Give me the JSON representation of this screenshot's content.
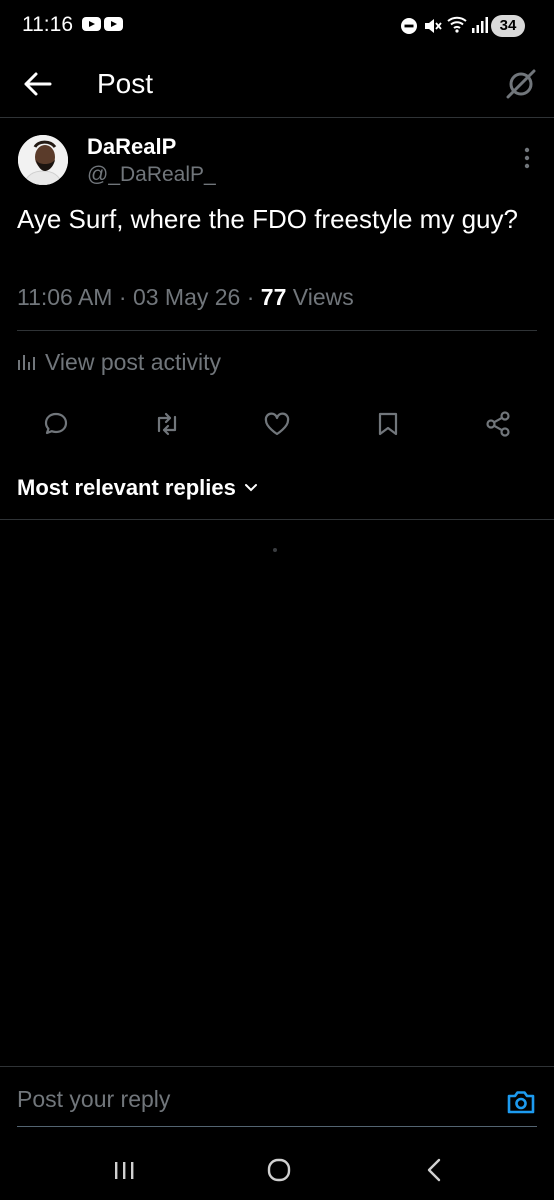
{
  "status_bar": {
    "time": "11:16",
    "battery": "34"
  },
  "header": {
    "title": "Post"
  },
  "post": {
    "author_name": "DaRealP",
    "author_handle": "@_DaRealP_",
    "text": "Aye Surf, where the FDO freestyle my guy?",
    "time": "11:06 AM",
    "date": "03 May 26",
    "views_count": "77",
    "views_label": "Views",
    "activity_label": "View post activity"
  },
  "replies": {
    "sort_label": "Most relevant replies"
  },
  "reply_bar": {
    "placeholder": "Post your reply"
  },
  "colors": {
    "background": "#000000",
    "text": "#e7e9ea",
    "muted": "#71767b",
    "accent": "#1d9bf0",
    "divider": "#2f3336"
  },
  "icons": {
    "back": "arrow-left-icon",
    "grok": "grok-icon",
    "more": "more-vertical-icon",
    "activity": "bar-chart-icon",
    "reply": "reply-icon",
    "repost": "repost-icon",
    "like": "heart-icon",
    "bookmark": "bookmark-icon",
    "share": "share-icon",
    "sort": "chevron-down-icon",
    "camera": "camera-icon"
  }
}
